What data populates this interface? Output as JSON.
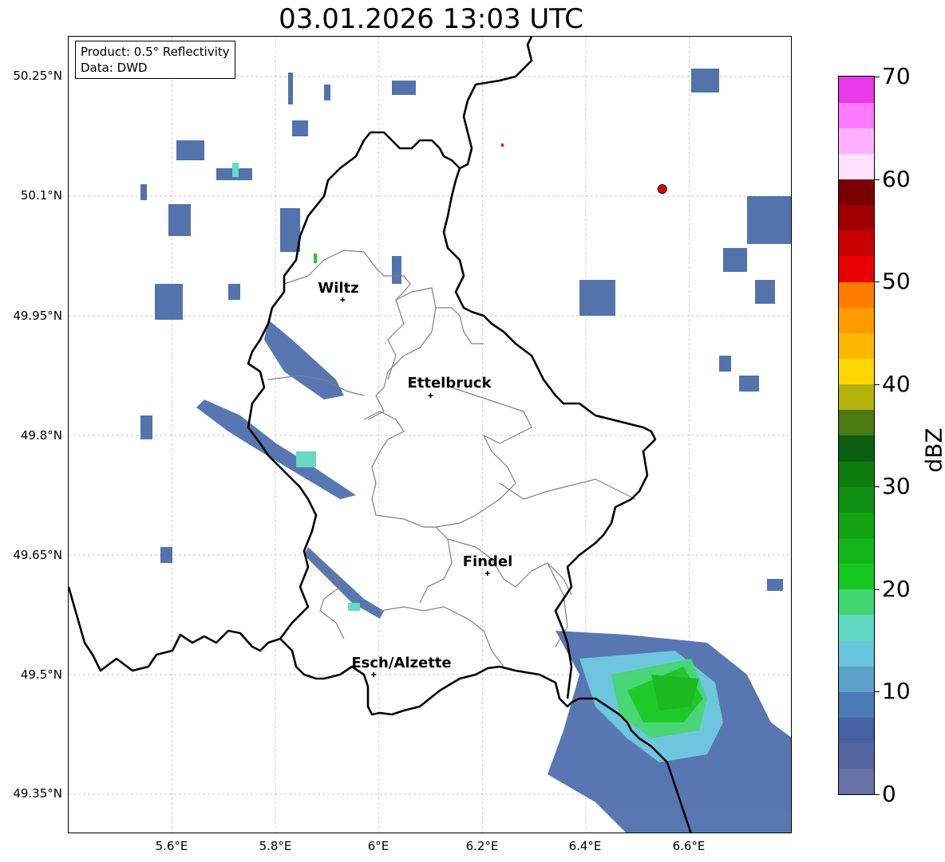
{
  "title": "03.01.2026 13:03 UTC",
  "info": {
    "product": "Product: 0.5° Reflectivity",
    "source": "Data: DWD"
  },
  "axes": {
    "lat_labels": [
      "50.25°N",
      "50.1°N",
      "49.95°N",
      "49.8°N",
      "49.65°N",
      "49.5°N",
      "49.35°N"
    ],
    "lon_labels": [
      "5.6°E",
      "5.8°E",
      "6°E",
      "6.2°E",
      "6.4°E",
      "6.6°E"
    ],
    "lat_values": [
      50.25,
      50.1,
      49.95,
      49.8,
      49.65,
      49.5,
      49.35
    ],
    "lon_values": [
      5.6,
      5.8,
      6.0,
      6.2,
      6.4,
      6.6
    ],
    "lon_range": [
      5.4,
      6.8
    ],
    "lat_range": [
      49.3,
      50.3
    ],
    "grid": true
  },
  "cities": [
    {
      "name": "Wiltz",
      "lon": 5.93,
      "lat": 49.97
    },
    {
      "name": "Ettelbruck",
      "lon": 6.1,
      "lat": 49.85
    },
    {
      "name": "Findel",
      "lon": 6.21,
      "lat": 49.627
    },
    {
      "name": "Esch/Alzette",
      "lon": 5.99,
      "lat": 49.5
    }
  ],
  "radar_site": {
    "lon": 6.548,
    "lat": 50.109,
    "color": "#e00000"
  },
  "colorbar": {
    "label": "dBZ",
    "min": 0,
    "max": 70,
    "ticks": [
      "0",
      "10",
      "20",
      "30",
      "40",
      "50",
      "60",
      "70"
    ],
    "colors": [
      "#6673a6",
      "#5565a0",
      "#4560a3",
      "#4a7ab3",
      "#5ba0c8",
      "#67c4dd",
      "#5fd7c2",
      "#3fd46f",
      "#12c81f",
      "#11b618",
      "#13a312",
      "#0f8f12",
      "#0d7d10",
      "#0a6010",
      "#4a7a10",
      "#b2b20a",
      "#ffd700",
      "#ffb800",
      "#ff9a00",
      "#ff7c00",
      "#e80000",
      "#c80000",
      "#a00000",
      "#7a0000",
      "#ffe0ff",
      "#ffb0ff",
      "#ff78ff",
      "#e83ae8"
    ]
  }
}
